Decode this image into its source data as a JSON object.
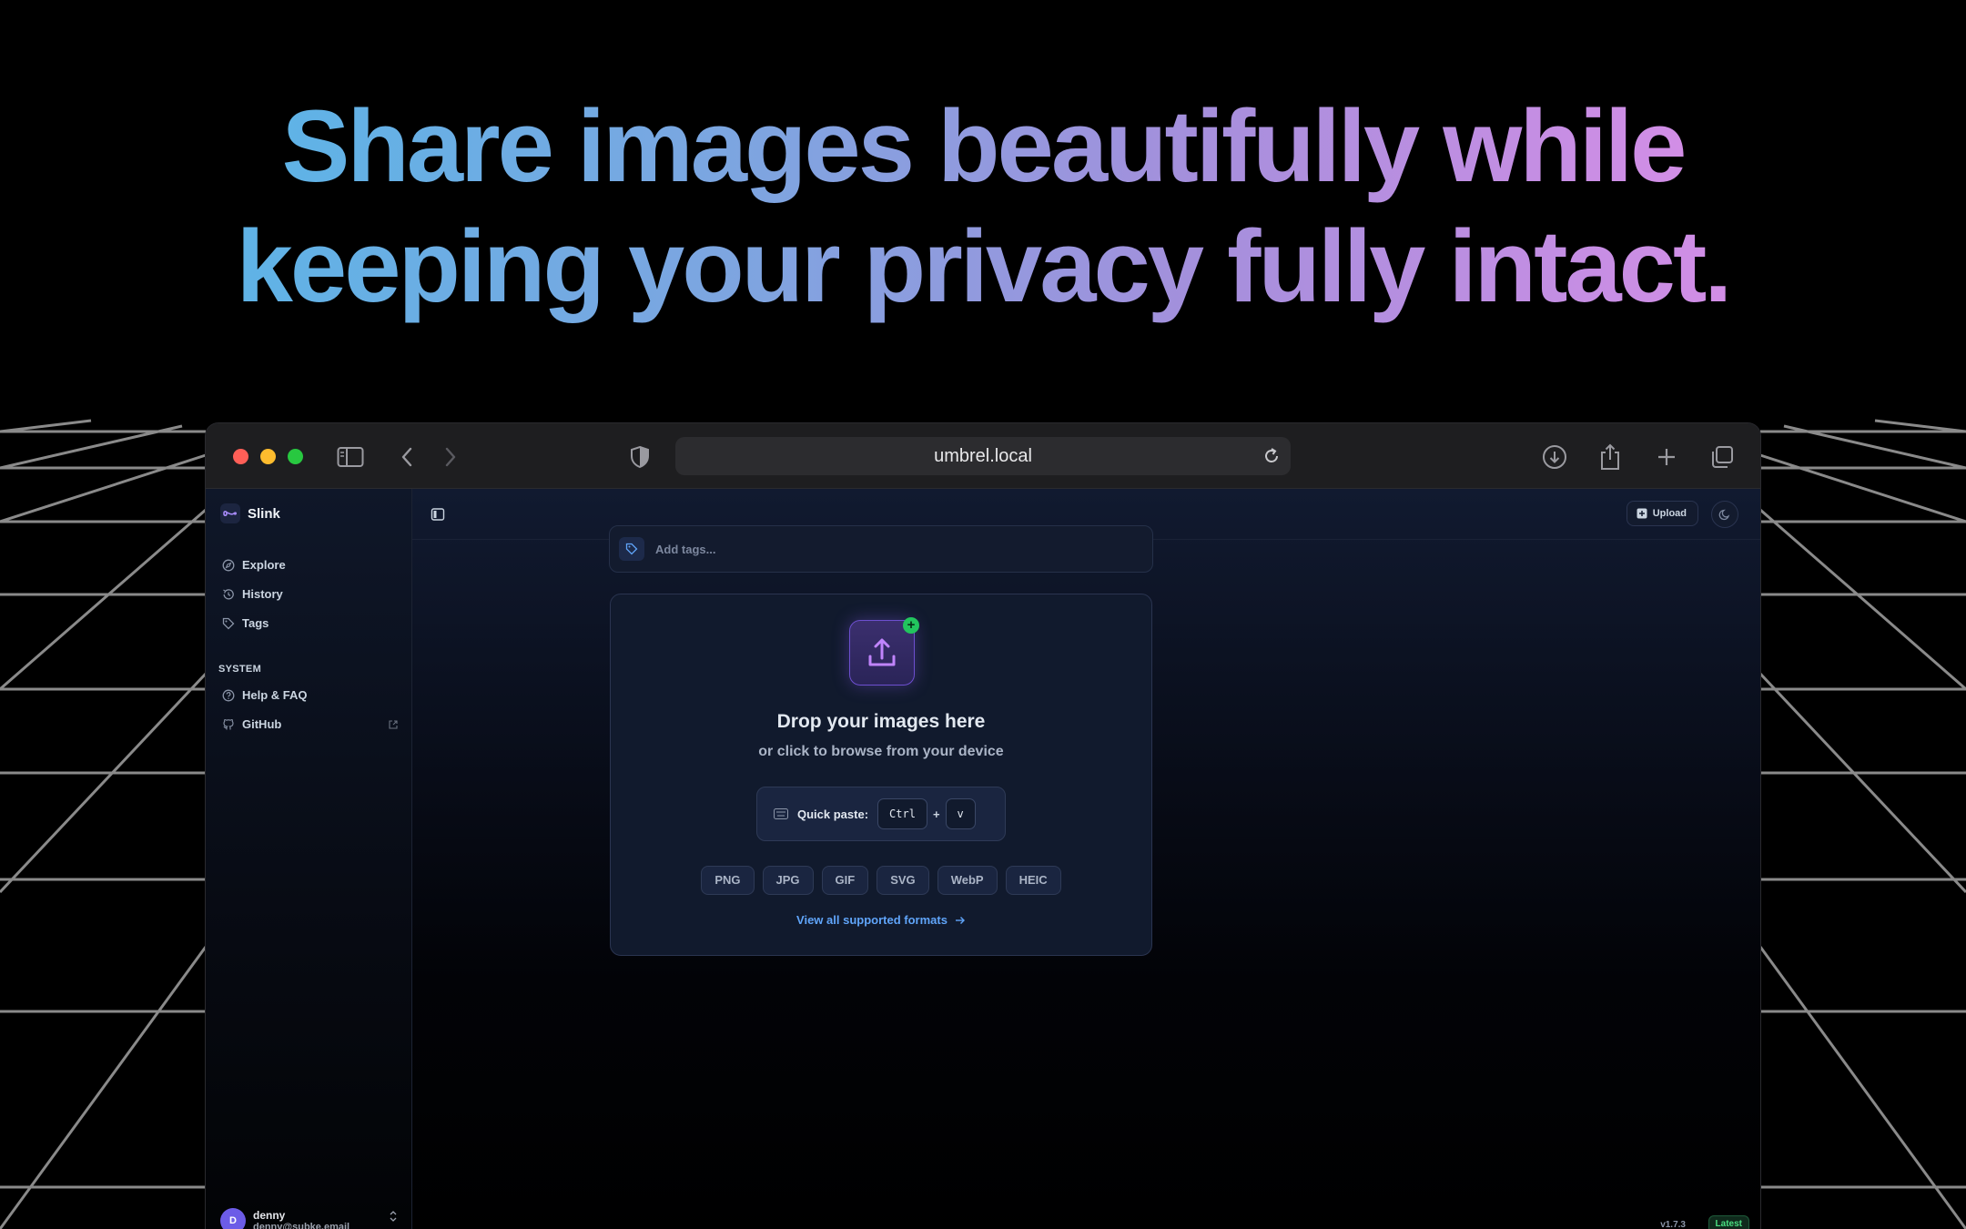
{
  "headline": {
    "line1": "Share images beautifully while",
    "line2": "keeping your privacy fully intact."
  },
  "browser": {
    "url": "umbrel.local"
  },
  "sidebar": {
    "app_name": "Slink",
    "items": [
      {
        "label": "Explore",
        "icon": "compass-icon"
      },
      {
        "label": "History",
        "icon": "history-icon"
      },
      {
        "label": "Tags",
        "icon": "tag-icon"
      }
    ],
    "system_label": "SYSTEM",
    "system_items": [
      {
        "label": "Help & FAQ",
        "icon": "help-icon"
      },
      {
        "label": "GitHub",
        "icon": "github-icon"
      }
    ],
    "user": {
      "initial": "D",
      "name": "denny",
      "email": "denny@subke.email"
    }
  },
  "header": {
    "upload_label": "Upload"
  },
  "tags": {
    "placeholder": "Add tags..."
  },
  "dropzone": {
    "title": "Drop your images here",
    "subtitle": "or click to browse from your device",
    "quick_paste_label": "Quick paste:",
    "key1": "Ctrl",
    "plus": "+",
    "key2": "v",
    "formats": [
      "PNG",
      "JPG",
      "GIF",
      "SVG",
      "WebP",
      "HEIC"
    ],
    "view_all": "View all supported formats"
  },
  "footer": {
    "version": "v1.7.3",
    "badge": "Latest"
  },
  "colors": {
    "accent_purple": "#a855f7",
    "accent_green": "#22c55e",
    "link_blue": "#60a5fa"
  }
}
